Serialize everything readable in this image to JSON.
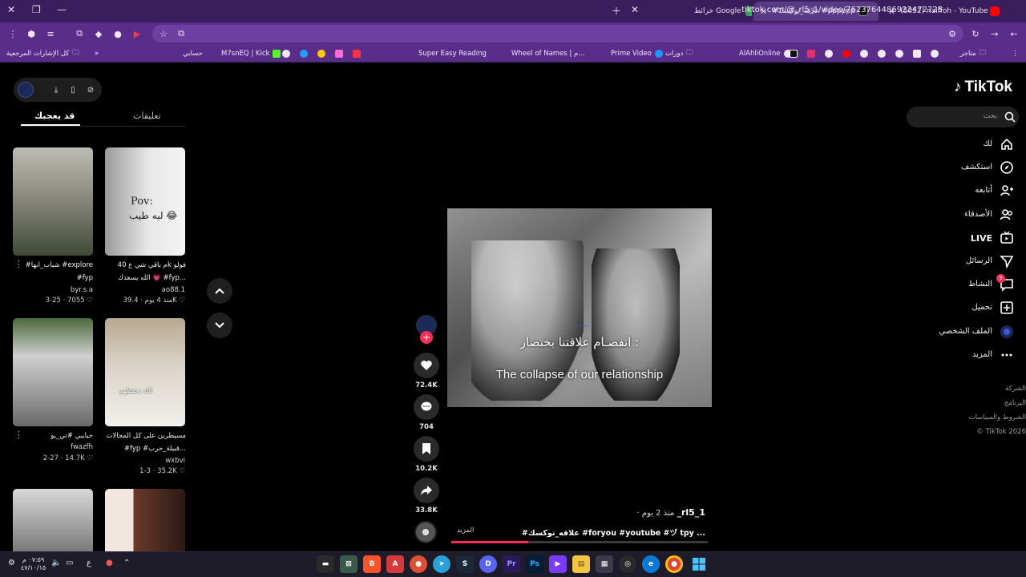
{
  "browser": {
    "tabs": [
      {
        "title": "(5052) naiffoh - YouTube",
        "fav_color": "#ff0000"
      },
      {
        "title": "#علاقه_توكسك #pppppppppp",
        "fav_color": "#111111"
      },
      {
        "title": "خرائط Google",
        "fav_color": "#34a853"
      }
    ],
    "url": "tiktok.com/@_rl5_1/video/7623764486922472725",
    "bookmarks_folder": "كل الإشارات المرجعية",
    "bookmarks": [
      "متاجر",
      "AlAhliOnline",
      "دورات",
      "Prime Video",
      "Wheel of Names | م...",
      "Super Easy Reading",
      "M7snEQ | Kick",
      "حسابي"
    ]
  },
  "tiktok": {
    "logo": "TikTok",
    "search_placeholder": "بحث",
    "nav": [
      {
        "label": "لك",
        "icon": "home-icon",
        "bold": false
      },
      {
        "label": "استكشف",
        "icon": "compass-icon",
        "bold": false
      },
      {
        "label": "أتابعه",
        "icon": "user-follow-icon",
        "bold": false
      },
      {
        "label": "الأصدقاء",
        "icon": "friends-icon",
        "bold": false
      },
      {
        "label": "LIVE",
        "icon": "live-icon",
        "bold": true
      },
      {
        "label": "الرسائل",
        "icon": "send-icon",
        "bold": false
      },
      {
        "label": "النشاط",
        "icon": "activity-icon",
        "bold": false
      },
      {
        "label": "تحميل",
        "icon": "upload-icon",
        "bold": false
      },
      {
        "label": "الملف الشخصي",
        "icon": "avatar-icon",
        "bold": false
      },
      {
        "label": "المزيد",
        "icon": "more-icon",
        "bold": false
      }
    ],
    "activity_badge": "9",
    "footer": [
      "الشركة",
      "البرنامج",
      "الشروط والسياسات",
      "© TikTok 2026"
    ],
    "video": {
      "caption_ar": "انفصـام علاقتنا بختصار :",
      "caption_en": "The collapse of our relationship",
      "watermark": "____",
      "likes": "72.4K",
      "comments": "704",
      "saves": "10.2K",
      "shares": "33.8K",
      "username": "_rl5_1",
      "posted": "· منذ 2 يوم",
      "description": "#علاقه_توكسك #foryou #youtube #ヅ tpy ...",
      "more": "المزيد",
      "progress": 0.3
    },
    "panel": {
      "tab_comments": "تعليقات",
      "tab_foryou": "قد يعجبك",
      "cards": [
        {
          "title1": "م باقي شي ع 40k فولو",
          "title2": "الله يسعدك 💗 #fyp...",
          "user": "ao88.1",
          "likes": "39.4K",
          "date": "منذ 4 يوم",
          "overlay1": "Pov:",
          "overlay2": "ليه طيب 😂"
        },
        {
          "title1": "#شباب_ابها #explore",
          "title2": "#fyp",
          "user": "byr.s.a",
          "likes": "7055",
          "date": "3-25",
          "overlay1": "",
          "overlay2": ""
        },
        {
          "title1": "مسيطرين على كل المجالات",
          "title2": "#fyp #قبيلة_حرب...",
          "user": "wxbvi",
          "likes": "35.2K",
          "date": "1-3",
          "overlay1": "الله يحفظهم",
          "overlay2": ""
        },
        {
          "title1": "حبايبي #تي_يو",
          "title2": "",
          "user": "fwazfh",
          "likes": "14.7K",
          "date": "2-27",
          "overlay1": "",
          "overlay2": ""
        }
      ]
    }
  },
  "taskbar": {
    "time": "٠٧:٥٩ م",
    "date": "٤٧/١٠/١٥",
    "lang": "ع"
  }
}
